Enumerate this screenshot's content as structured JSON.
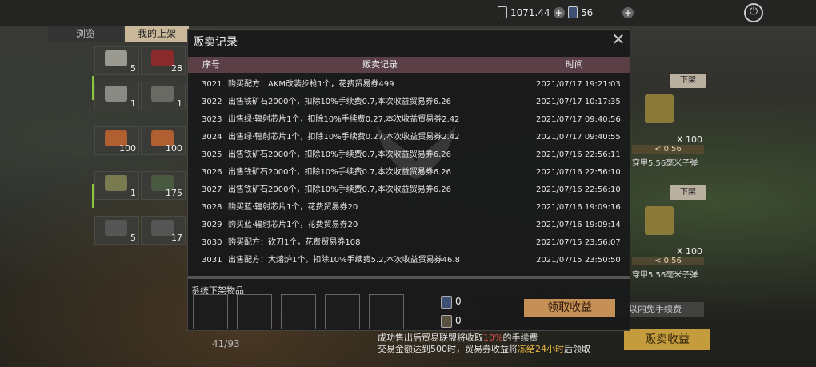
{
  "topbar": {
    "currency1": {
      "value": "1071.44",
      "icon": "coin-ticket-icon"
    },
    "currency2": {
      "value": "56",
      "icon": "trade-ticket-icon"
    }
  },
  "tabs": [
    {
      "label": "浏览"
    },
    {
      "label": "我的上架"
    }
  ],
  "inventory": [
    {
      "count": "5"
    },
    {
      "count": "28"
    },
    {
      "count": "1"
    },
    {
      "count": "1"
    },
    {
      "count": "100"
    },
    {
      "count": "100"
    },
    {
      "count": "1"
    },
    {
      "count": "175"
    },
    {
      "count": "5"
    },
    {
      "count": "17"
    }
  ],
  "left_count": "41/93",
  "right_listings": [
    {
      "button": "下架",
      "qty": "X 100",
      "price": "< 0.56",
      "name": "穿甲5.56毫米子弹"
    },
    {
      "button": "下架",
      "qty": "X 100",
      "price": "< 0.56",
      "name": "穿甲5.56毫米子弹"
    }
  ],
  "right_hint": "以内免手续费",
  "sell_income_button": "贩卖收益",
  "info": {
    "line1_a": "成功售出后贸易联盟将收取",
    "line1_red": "10%",
    "line1_b": "的手续费",
    "line2_a": "交易金额达到500时，贸易券收益将",
    "line2_yel": "冻结24小时",
    "line2_b": "后领取"
  },
  "modal": {
    "title": "贩卖记录",
    "columns": {
      "id": "序号",
      "record": "贩卖记录",
      "time": "时间"
    },
    "rows": [
      {
        "id": "3021",
        "desc": "购买配方：AKM改装步枪1个，花费贸易券499",
        "time": "2021/07/17 19:21:03"
      },
      {
        "id": "3022",
        "desc": "出售铁矿石2000个，扣除10%手续费0.7,本次收益贸易券6.26",
        "time": "2021/07/17 10:17:35"
      },
      {
        "id": "3023",
        "desc": "出售绿·辐射芯片1个，扣除10%手续费0.27,本次收益贸易券2.42",
        "time": "2021/07/17 09:40:56"
      },
      {
        "id": "3024",
        "desc": "出售绿·辐射芯片1个，扣除10%手续费0.27,本次收益贸易券2.42",
        "time": "2021/07/17 09:40:55"
      },
      {
        "id": "3025",
        "desc": "出售铁矿石2000个，扣除10%手续费0.7,本次收益贸易券6.26",
        "time": "2021/07/16 22:56:11"
      },
      {
        "id": "3026",
        "desc": "出售铁矿石2000个，扣除10%手续费0.7,本次收益贸易券6.26",
        "time": "2021/07/16 22:56:10"
      },
      {
        "id": "3027",
        "desc": "出售铁矿石2000个，扣除10%手续费0.7,本次收益贸易券6.26",
        "time": "2021/07/16 22:56:10"
      },
      {
        "id": "3028",
        "desc": "购买蓝·辐射芯片1个，花费贸易券20",
        "time": "2021/07/16 19:09:16"
      },
      {
        "id": "3029",
        "desc": "购买蓝·辐射芯片1个，花费贸易券20",
        "time": "2021/07/16 19:09:14"
      },
      {
        "id": "3030",
        "desc": "购买配方：砍刀1个，花费贸易券108",
        "time": "2021/07/15 23:56:07"
      },
      {
        "id": "3031",
        "desc": "出售配方：大熔炉1个，扣除10%手续费5.2,本次收益贸易券46.8",
        "time": "2021/07/15 23:50:50"
      }
    ],
    "system_label": "系统下架物品",
    "ticket1": "0",
    "ticket2": "0",
    "collect_button": "领取收益"
  }
}
